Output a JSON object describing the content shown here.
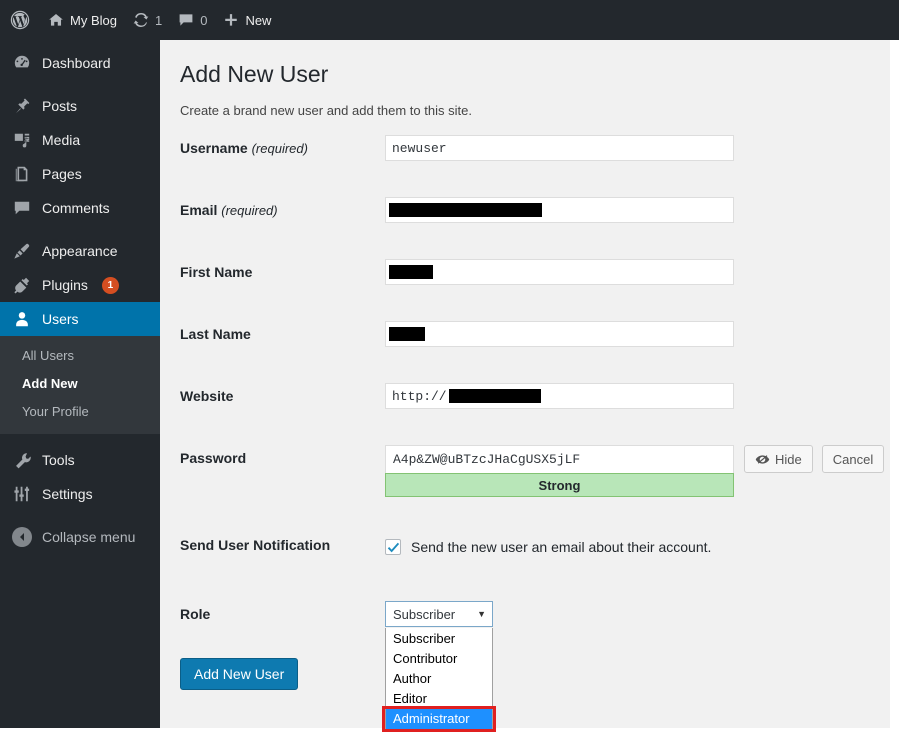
{
  "adminbar": {
    "logo_icon": "wordpress-logo-icon",
    "site_name": "My Blog",
    "site_icon": "home-icon",
    "updates_icon": "updates-icon",
    "updates_count": "1",
    "comments_icon": "comment-bubble-icon",
    "comments_count": "0",
    "new_icon": "plus-icon",
    "new_label": "New"
  },
  "sidebar": {
    "items": [
      {
        "label": "Dashboard",
        "icon": "dashboard-icon"
      },
      {
        "label": "Posts",
        "icon": "pin-icon"
      },
      {
        "label": "Media",
        "icon": "media-icon"
      },
      {
        "label": "Pages",
        "icon": "pages-icon"
      },
      {
        "label": "Comments",
        "icon": "comment-bubble-icon"
      },
      {
        "label": "Appearance",
        "icon": "paintbrush-icon"
      },
      {
        "label": "Plugins",
        "icon": "plug-icon",
        "badge": "1"
      },
      {
        "label": "Users",
        "icon": "user-icon"
      },
      {
        "label": "Tools",
        "icon": "wrench-icon"
      },
      {
        "label": "Settings",
        "icon": "settings-sliders-icon"
      },
      {
        "label": "Collapse menu",
        "icon": "collapse-arrow-icon"
      }
    ],
    "submenu": [
      {
        "label": "All Users"
      },
      {
        "label": "Add New"
      },
      {
        "label": "Your Profile"
      }
    ]
  },
  "page": {
    "title": "Add New User",
    "subtitle": "Create a brand new user and add them to this site."
  },
  "form": {
    "username": {
      "label": "Username",
      "required_note": "(required)",
      "value": "newuser"
    },
    "email": {
      "label": "Email",
      "required_note": "(required)",
      "value": ""
    },
    "first_name": {
      "label": "First Name",
      "value": ""
    },
    "last_name": {
      "label": "Last Name",
      "value": ""
    },
    "website": {
      "label": "Website",
      "value": "http://"
    },
    "password": {
      "label": "Password",
      "value": "A4p&ZW@uBTzcJHaCgUSX5jLF",
      "strength": "Strong",
      "hide_label": "Hide",
      "hide_icon": "eye-slash-icon",
      "cancel_label": "Cancel"
    },
    "notification": {
      "label": "Send User Notification",
      "checkbox_label": "Send the new user an email about their account.",
      "checked": true
    },
    "role": {
      "label": "Role",
      "selected": "Subscriber",
      "caret_icon": "chevron-down-icon",
      "options": [
        "Subscriber",
        "Contributor",
        "Author",
        "Editor",
        "Administrator"
      ],
      "highlighted_option": "Administrator"
    },
    "submit_label": "Add New User"
  },
  "colors": {
    "accent": "#0073aa",
    "admin_bg": "#23282d",
    "submenu_bg": "#32373c",
    "content_bg": "#f1f1f1",
    "badge": "#d54e21",
    "strength_bg": "#b8e6b8",
    "option_highlight": "#1e90ff",
    "annotation": "#e02020"
  }
}
